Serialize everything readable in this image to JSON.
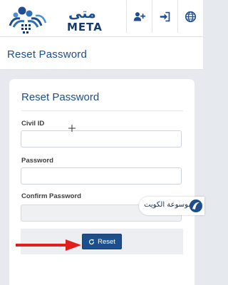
{
  "header": {
    "logo": {
      "arabic_text": "متى",
      "latin_text": "META",
      "icon": "kuwait-towers-logo-icon"
    },
    "nav_icons": [
      {
        "icon": "user-plus-icon",
        "name": "register"
      },
      {
        "icon": "sign-in-icon",
        "name": "login"
      },
      {
        "icon": "globe-icon",
        "name": "language"
      }
    ]
  },
  "page": {
    "title": "Reset Password"
  },
  "form": {
    "title": "Reset Password",
    "fields": {
      "civil_id": {
        "label": "Civil ID",
        "value": "",
        "placeholder": ""
      },
      "password": {
        "label": "Password",
        "value": "",
        "placeholder": ""
      },
      "confirm_password": {
        "label": "Confirm Password",
        "value": "",
        "placeholder": ""
      }
    },
    "reset_button": {
      "label": "Reset",
      "icon": "refresh-icon"
    }
  },
  "watermark": {
    "text": "موسوعة الكويت",
    "icon": "encyclopedia-logo-icon"
  },
  "annotation": {
    "arrow_color": "#e11d1d"
  },
  "colors": {
    "brand_blue": "#1d4f8c",
    "page_background": "#e6e9ee"
  }
}
